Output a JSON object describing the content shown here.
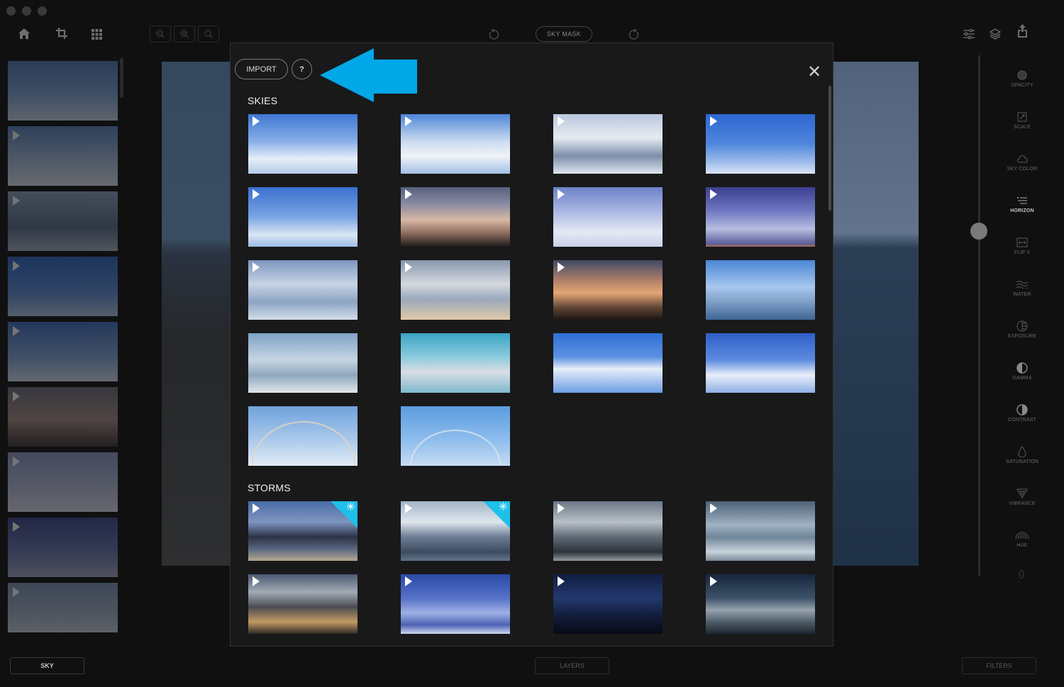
{
  "toolbar": {
    "sky_mask_label": "SKY MASK",
    "icons": [
      "home-icon",
      "crop-icon",
      "grid-icon",
      "zoom-out-icon",
      "zoom-in-icon",
      "zoom-fit-icon",
      "undo-icon",
      "redo-icon",
      "sliders-icon",
      "layers-icon",
      "share-icon"
    ]
  },
  "modal": {
    "import_label": "IMPORT",
    "help_label": "?",
    "close_label": "✕",
    "sections": [
      {
        "title": "SKIES"
      },
      {
        "title": "STORMS"
      }
    ],
    "accent_color": "#00a8e8"
  },
  "tools": [
    {
      "label": "OPACITY",
      "icon": "opacity-icon"
    },
    {
      "label": "SCALE",
      "icon": "scale-icon"
    },
    {
      "label": "SKY COLOR",
      "icon": "cloud-icon"
    },
    {
      "label": "HORIZON",
      "icon": "horizon-icon"
    },
    {
      "label": "FLIP X",
      "icon": "flip-icon"
    },
    {
      "label": "WATER",
      "icon": "water-icon"
    },
    {
      "label": "EXPOSURE",
      "icon": "exposure-icon"
    },
    {
      "label": "GAMMA",
      "icon": "gamma-icon"
    },
    {
      "label": "CONTRAST",
      "icon": "contrast-icon"
    },
    {
      "label": "SATURATION",
      "icon": "drop-icon"
    },
    {
      "label": "VIBRANCE",
      "icon": "vibrance-icon"
    },
    {
      "label": "HUE",
      "icon": "hue-icon"
    }
  ],
  "bottom_tabs": {
    "sky": "SKY",
    "layers": "LAYERS",
    "filters": "FILTERS"
  }
}
